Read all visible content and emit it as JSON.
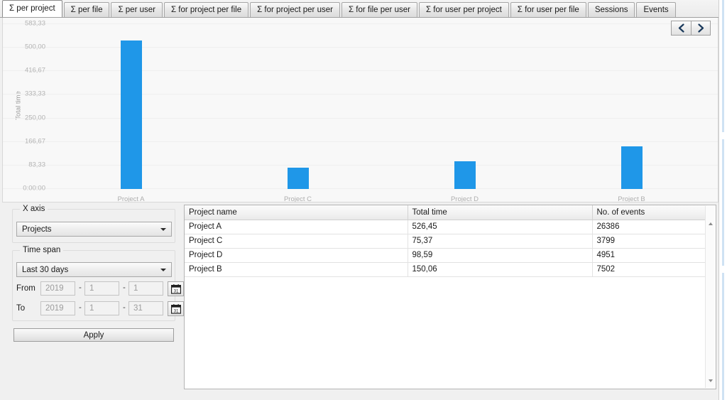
{
  "tabs": [
    {
      "label": "Σ per project",
      "active": true
    },
    {
      "label": "Σ per file",
      "active": false
    },
    {
      "label": "Σ per user",
      "active": false
    },
    {
      "label": "Σ for project per file",
      "active": false
    },
    {
      "label": "Σ for project per user",
      "active": false
    },
    {
      "label": "Σ for file per user",
      "active": false
    },
    {
      "label": "Σ for user per project",
      "active": false
    },
    {
      "label": "Σ for user per file",
      "active": false
    },
    {
      "label": "Sessions",
      "active": false
    },
    {
      "label": "Events",
      "active": false
    }
  ],
  "chart_nav": {
    "prev_icon": "chevron-left-icon",
    "next_icon": "chevron-right-icon"
  },
  "chart_data": {
    "type": "bar",
    "title": "",
    "xlabel": "",
    "ylabel": "Total time",
    "categories": [
      "Project A",
      "Project C",
      "Project D",
      "Project B"
    ],
    "values": [
      526.45,
      75.37,
      98.59,
      150.06
    ],
    "ytick_labels": [
      "583,33",
      "500,00",
      "416,67",
      "333,33",
      "250,00",
      "166,67",
      "83,33",
      "0:00:00"
    ],
    "ytick_values": [
      583.33,
      500.0,
      416.67,
      333.33,
      250.0,
      166.67,
      83.33,
      0
    ],
    "ylim": [
      0,
      583.33
    ],
    "grid": true,
    "legend": "none",
    "bar_color": "#1f97e8",
    "plot_background": "#f8f8f8"
  },
  "controls": {
    "x_axis": {
      "group_label": "X axis",
      "selected": "Projects",
      "dropdown_icon": "chevron-down-icon"
    },
    "time_span": {
      "group_label": "Time span",
      "selected": "Last 30 days",
      "dropdown_icon": "chevron-down-icon",
      "from_label": "From",
      "from_year": "2019",
      "from_month": "1",
      "from_day": "1",
      "to_label": "To",
      "to_year": "2019",
      "to_month": "1",
      "to_day": "31",
      "separator": "-",
      "calendar_icon": "calendar-icon",
      "calendar_glyph": "31"
    },
    "apply_label": "Apply"
  },
  "table": {
    "columns": [
      "Project name",
      "Total time",
      "No. of events"
    ],
    "rows": [
      {
        "name": "Project A",
        "total_time": "526,45",
        "events": "26386"
      },
      {
        "name": "Project C",
        "total_time": "75,37",
        "events": "3799"
      },
      {
        "name": "Project D",
        "total_time": "98,59",
        "events": "4951"
      },
      {
        "name": "Project B",
        "total_time": "150,06",
        "events": "7502"
      }
    ]
  }
}
